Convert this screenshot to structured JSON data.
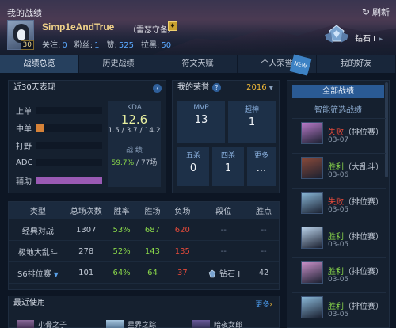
{
  "window": {
    "title": "我的战绩",
    "refresh_label": "刷新",
    "refresh_icon": "refresh-icon"
  },
  "profile": {
    "level": "30",
    "name": "Simp1eAndTrue",
    "title": "（雷瑟守备）",
    "follow_label": "关注:",
    "follow_value": "0",
    "fans_label": "粉丝:",
    "fans_value": "1",
    "likes_label": "赞:",
    "likes_value": "525",
    "block_label": "拉黑:",
    "block_value": "50",
    "rank": "钻石 I",
    "rank_sep": "▸"
  },
  "tabs": [
    {
      "label": "战绩总览",
      "active": true
    },
    {
      "label": "历史战绩"
    },
    {
      "label": "符文天赋"
    },
    {
      "label": "个人荣誉",
      "badge": "NEW"
    },
    {
      "label": "我的好友"
    }
  ],
  "recent": {
    "title": "近30天表现",
    "roles": [
      {
        "name": "上单",
        "share": 0.0
      },
      {
        "name": "中单",
        "share": 0.12
      },
      {
        "name": "打野",
        "share": 0.0
      },
      {
        "name": "ADC",
        "share": 0.0
      },
      {
        "name": "辅助",
        "share": 1.0
      }
    ],
    "kda_label": "KDA",
    "kda_value": "12.6",
    "kda_detail": "1.5 / 3.7 / 14.2",
    "record_label": "战 绩",
    "winrate": "59.7%",
    "games": " / 77场"
  },
  "honor": {
    "title": "我的荣誉",
    "year": "2016",
    "boxes": [
      {
        "label": "MVP",
        "value": "13"
      },
      {
        "label": "超神",
        "value": "1"
      },
      {
        "label": "五杀",
        "value": "0"
      },
      {
        "label": "四杀",
        "value": "1"
      },
      {
        "label": "更多",
        "value": "..."
      }
    ]
  },
  "table": {
    "headers": [
      "类型",
      "总场次数",
      "胜率",
      "胜场",
      "负场",
      "段位",
      "胜点"
    ],
    "rows": [
      {
        "type": "经典对战",
        "total": "1307",
        "rate": "53%",
        "win": "687",
        "lose": "620",
        "rank": "--",
        "pts": "--"
      },
      {
        "type": "极地大乱斗",
        "total": "278",
        "rate": "52%",
        "win": "143",
        "lose": "135",
        "rank": "--",
        "pts": "--"
      },
      {
        "type": "S6排位赛",
        "total": "101",
        "rate": "64%",
        "win": "64",
        "lose": "37",
        "rank": "钻石 I",
        "pts": "42"
      }
    ]
  },
  "used": {
    "title": "最近使用",
    "more": "更多",
    "more_caret": "›",
    "champs": [
      "小骨之子",
      "星界之踪",
      "暗夜女郎"
    ]
  },
  "sidebar": {
    "all_label": "全部战绩",
    "smart_label": "智能筛选战绩",
    "games": [
      {
        "result": "失败",
        "mode": "（排位赛）",
        "date": "03-07",
        "win": false,
        "color": "#b87ac8"
      },
      {
        "result": "胜利",
        "mode": "（大乱斗）",
        "date": "03-06",
        "win": true,
        "color": "#8a4a3a"
      },
      {
        "result": "失败",
        "mode": "（排位赛）",
        "date": "03-05",
        "win": false,
        "color": "#8ab8d8"
      },
      {
        "result": "胜利",
        "mode": "（排位赛）",
        "date": "03-05",
        "win": true,
        "color": "#b8d0e8"
      },
      {
        "result": "胜利",
        "mode": "（排位赛）",
        "date": "03-05",
        "win": true,
        "color": "#c890c8"
      },
      {
        "result": "胜利",
        "mode": "（排位赛）",
        "date": "03-05",
        "win": true,
        "color": "#8ab8d8"
      }
    ]
  }
}
